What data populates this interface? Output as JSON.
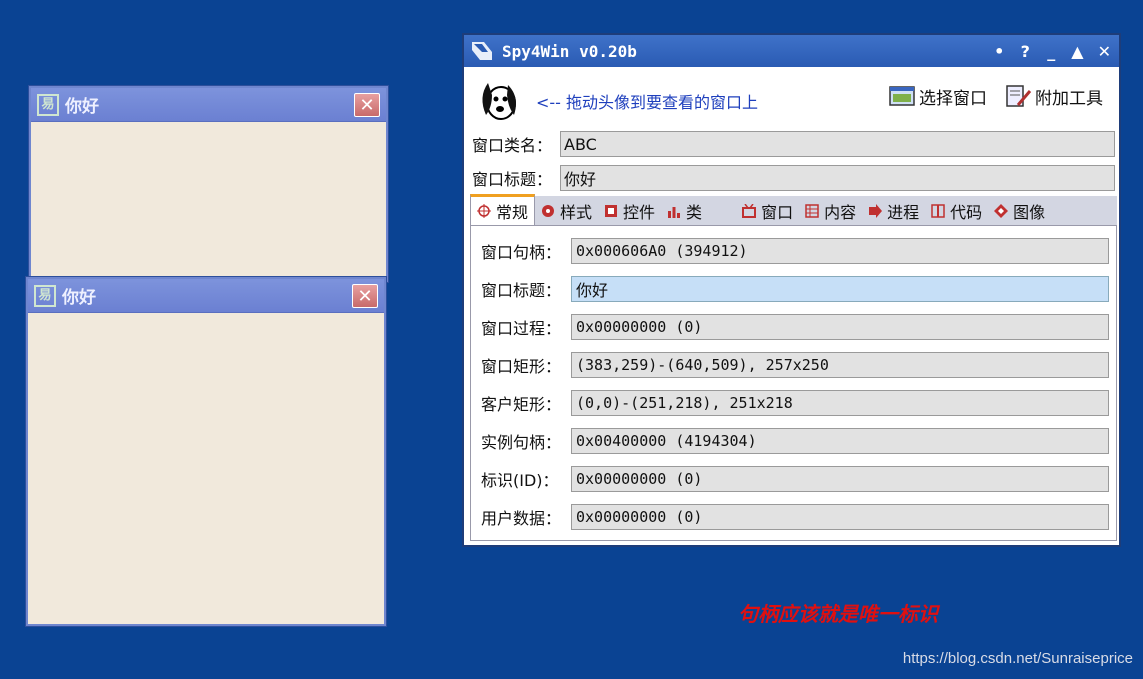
{
  "mini_windows": [
    {
      "title": "你好",
      "close": "✕"
    },
    {
      "title": "你好",
      "close": "✕"
    }
  ],
  "spy": {
    "title": "Spy4Win v0.20b",
    "controls": [
      "•",
      "?",
      "_",
      "▲",
      "✕"
    ],
    "drag_hint": "<-- 拖动头像到要查看的窗口上",
    "select_window": "选择窗口",
    "extra_tools": "附加工具",
    "class_label": "窗口类名：",
    "class_value": "ABC",
    "caption_label": "窗口标题：",
    "caption_value": "你好",
    "tabs": [
      {
        "label": "常规",
        "icon": "crosshair-icon",
        "color": "#c03030"
      },
      {
        "label": "样式",
        "icon": "style-icon",
        "color": "#c03030"
      },
      {
        "label": "控件",
        "icon": "control-icon",
        "color": "#c03030"
      },
      {
        "label": "类",
        "icon": "bar-chart-icon",
        "color": "#c03030"
      },
      {
        "label": "窗口",
        "icon": "window-icon",
        "color": "#c03030"
      },
      {
        "label": "内容",
        "icon": "list-icon",
        "color": "#c03030"
      },
      {
        "label": "进程",
        "icon": "process-icon",
        "color": "#c03030"
      },
      {
        "label": "代码",
        "icon": "code-icon",
        "color": "#c03030"
      },
      {
        "label": "图像",
        "icon": "image-icon",
        "color": "#c03030"
      }
    ],
    "properties": [
      {
        "label": "窗口句柄：",
        "value": "0x000606A0 (394912)"
      },
      {
        "label": "窗口标题：",
        "value": "你好"
      },
      {
        "label": "窗口过程：",
        "value": "0x00000000 (0)"
      },
      {
        "label": "窗口矩形：",
        "value": "(383,259)-(640,509), 257x250"
      },
      {
        "label": "客户矩形：",
        "value": "(0,0)-(251,218), 251x218"
      },
      {
        "label": "实例句柄：",
        "value": "0x00400000 (4194304)"
      },
      {
        "label": "标识(ID)：",
        "value": "0x00000000 (0)"
      },
      {
        "label": "用户数据：",
        "value": "0x00000000 (0)"
      }
    ]
  },
  "annotation": "句柄应该就是唯一标识",
  "watermark": "https://blog.csdn.net/Sunraiseprice",
  "colors": {
    "desktop": "#0a4393",
    "annotation": "#e01010",
    "title_bar": "#2a5bb3"
  }
}
